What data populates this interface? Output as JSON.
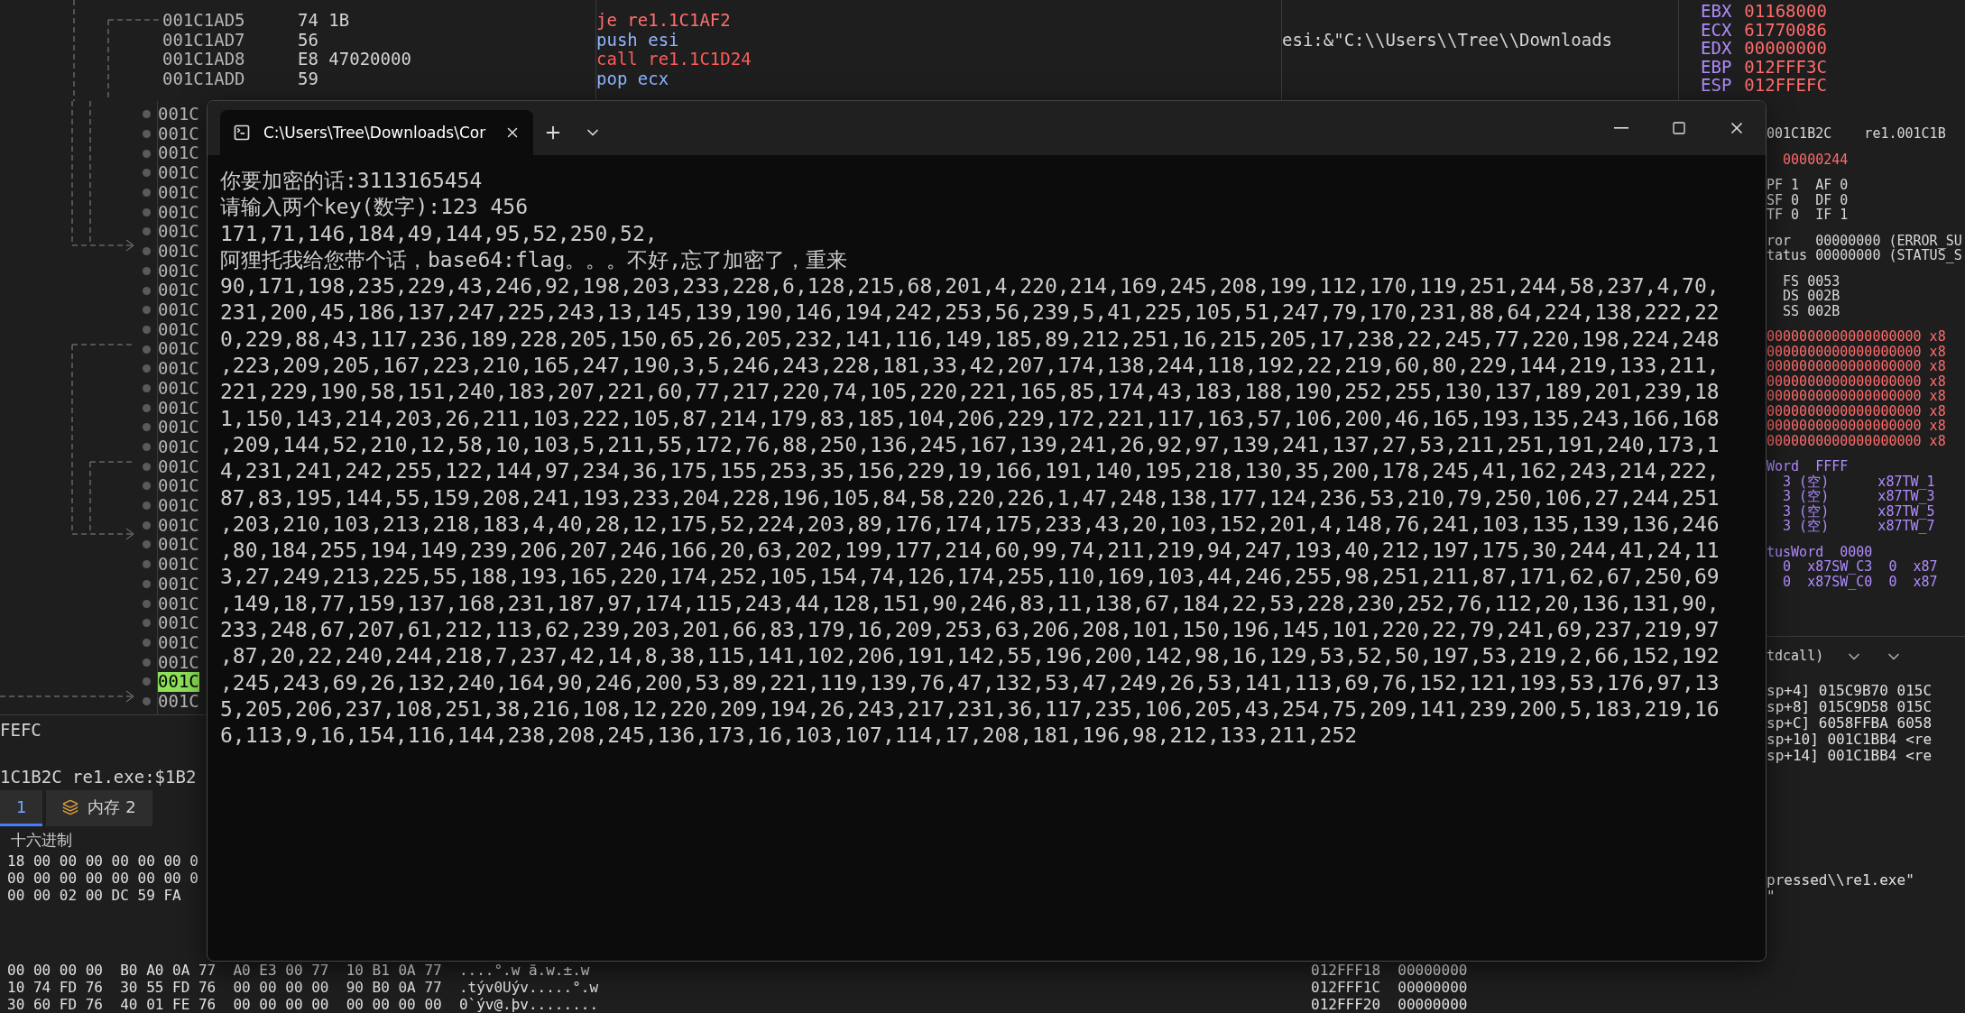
{
  "debugger": {
    "disassembly": [
      {
        "address": "001C1AD5",
        "bytes": "74 1B",
        "op": "je",
        "operand": "re1.1C1AF2",
        "kind": "jump"
      },
      {
        "address": "001C1AD7",
        "bytes": "56",
        "op": "push",
        "operand": "esi",
        "kind": "plain"
      },
      {
        "address": "001C1AD8",
        "bytes": "E8 47020000",
        "op": "call",
        "operand": "re1.1C1D24",
        "kind": "call"
      },
      {
        "address": "001C1ADD",
        "bytes": "59",
        "op": "pop",
        "operand": "ecx",
        "kind": "plain"
      }
    ],
    "comment": "esi:&\"C:\\\\Users\\\\Tree\\\\Downloads",
    "registers": [
      {
        "name": "EBX",
        "value": "01168000"
      },
      {
        "name": "ECX",
        "value": "61770086"
      },
      {
        "name": "EDX",
        "value": "00000000"
      },
      {
        "name": "EBP",
        "value": "012FFF3C"
      },
      {
        "name": "ESP",
        "value": "012FFEFC"
      }
    ],
    "address_column": [
      {
        "text": "001C",
        "selected": false
      },
      {
        "text": "001C",
        "selected": false
      },
      {
        "text": "001C",
        "selected": false
      },
      {
        "text": "001C",
        "selected": false
      },
      {
        "text": "001C",
        "selected": false
      },
      {
        "text": "001C",
        "selected": false
      },
      {
        "text": "001C",
        "selected": false
      },
      {
        "text": "001C",
        "selected": false
      },
      {
        "text": "001C",
        "selected": false
      },
      {
        "text": "001C",
        "selected": false
      },
      {
        "text": "001C",
        "selected": false
      },
      {
        "text": "001C",
        "selected": false
      },
      {
        "text": "001C",
        "selected": false
      },
      {
        "text": "001C",
        "selected": false
      },
      {
        "text": "001C",
        "selected": false
      },
      {
        "text": "001C",
        "selected": false
      },
      {
        "text": "001C",
        "selected": false
      },
      {
        "text": "001C",
        "selected": false
      },
      {
        "text": "001C",
        "selected": false
      },
      {
        "text": "001C",
        "selected": false
      },
      {
        "text": "001C",
        "selected": false
      },
      {
        "text": "001C",
        "selected": false
      },
      {
        "text": "001C",
        "selected": false
      },
      {
        "text": "001C",
        "selected": false
      },
      {
        "text": "001C",
        "selected": false
      },
      {
        "text": "001C",
        "selected": false
      },
      {
        "text": "001C",
        "selected": false
      },
      {
        "text": "001C",
        "selected": false
      },
      {
        "text": "001C",
        "selected": false
      },
      {
        "text": "001C",
        "selected": true
      },
      {
        "text": "001C",
        "selected": false
      }
    ],
    "info_lines": [
      "FEFC",
      "1C1B2C re1.exe:$1B2"
    ],
    "dump_tabs": [
      {
        "label": "1",
        "selected": true
      },
      {
        "label": "内存 2",
        "selected": false
      }
    ],
    "dump_header": "十六进制",
    "dump_rows": [
      "18 00 00 00 00 00 00 0",
      "00 00 00 00 00 00 00 0",
      "00 00 02 00 DC 59 FA"
    ],
    "dump_rows_bottom": [
      "00 00 00 00  B0 A0 0A 77  A0 E3 00 77  10 B1 0A 77  ....°.w ã.w.±.w",
      "10 74 FD 76  30 55 FD 76  00 00 00 00  90 B0 0A 77  .týv0Uýv.....°.w",
      "30 60 FD 76  40 01 FE 76  00 00 00 00  00 00 00 00  0`ýv@.þv........"
    ],
    "stack_bottom": [
      "012FFF18  00000000",
      "012FFF1C  00000000",
      "012FFF20  00000000"
    ],
    "right_sections": [
      {
        "kind": "mixed",
        "lines": [
          "001C1B2C    re1.001C1B"
        ]
      },
      {
        "kind": "changed",
        "lines": [
          "  00000244"
        ]
      },
      {
        "kind": "mixed",
        "lines": [
          "PF 1  AF 0",
          "SF 0  DF 0",
          "TF 0  IF 1"
        ]
      },
      {
        "kind": "mixed",
        "lines": [
          "ror   00000000 (ERROR_SU",
          "tatus 00000000 (STATUS_S"
        ]
      },
      {
        "kind": "mixed",
        "lines": [
          "  FS 0053",
          "  DS 002B",
          "  SS 002B"
        ]
      },
      {
        "kind": "changed",
        "lines": [
          "0000000000000000000 x8",
          "0000000000000000000 x8",
          "0000000000000000000 x8",
          "0000000000000000000 x8",
          "0000000000000000000 x8",
          "0000000000000000000 x8",
          "0000000000000000000 x8",
          "0000000000000000000 x8"
        ]
      },
      {
        "kind": "label",
        "lines": [
          "Word  FFFF",
          "  3 (空)      x87TW_1",
          "  3 (空)      x87TW_3",
          "  3 (空)      x87TW_5",
          "  3 (空)      x87TW_7"
        ]
      },
      {
        "kind": "label",
        "lines": [
          "tusWord  0000",
          "  0  x87SW_C3  0  x87",
          "  0  x87SW_C0  0  x87"
        ]
      }
    ],
    "call_convention": "tdcall)",
    "stack_lines": [
      "sp+4] 015C9B70 015C",
      "sp+8] 015C9D58 015C",
      "sp+C] 6058FFBA 6058",
      "sp+10] 001C1BB4 <re",
      "sp+14] 001C1BB4 <re"
    ],
    "command_lines": [
      "pressed\\\\re1.exe\"",
      "\""
    ]
  },
  "console": {
    "title": "C:\\Users\\Tree\\Downloads\\Cor",
    "lines": [
      "你要加密的话:3113165454",
      "请输入两个key(数字):123 456",
      "171,71,146,184,49,144,95,52,250,52,",
      "阿狸托我给您带个话，base64:flag。。。不好,忘了加密了，重来",
      "90,171,198,235,229,43,246,92,198,203,233,228,6,128,215,68,201,4,220,214,169,245,208,199,112,170,119,251,244,58,237,4,70,",
      "231,200,45,186,137,247,225,243,13,145,139,190,146,194,242,253,56,239,5,41,225,105,51,247,79,170,231,88,64,224,138,222,22",
      "0,229,88,43,117,236,189,228,205,150,65,26,205,232,141,116,149,185,89,212,251,16,215,205,17,238,22,245,77,220,198,224,248",
      ",223,209,205,167,223,210,165,247,190,3,5,246,243,228,181,33,42,207,174,138,244,118,192,22,219,60,80,229,144,219,133,211,",
      "221,229,190,58,151,240,183,207,221,60,77,217,220,74,105,220,221,165,85,174,43,183,188,190,252,255,130,137,189,201,239,18",
      "1,150,143,214,203,26,211,103,222,105,87,214,179,83,185,104,206,229,172,221,117,163,57,106,200,46,165,193,135,243,166,168",
      ",209,144,52,210,12,58,10,103,5,211,55,172,76,88,250,136,245,167,139,241,26,92,97,139,241,137,27,53,211,251,191,240,173,1",
      "4,231,241,242,255,122,144,97,234,36,175,155,253,35,156,229,19,166,191,140,195,218,130,35,200,178,245,41,162,243,214,222,",
      "87,83,195,144,55,159,208,241,193,233,204,228,196,105,84,58,220,226,1,47,248,138,177,124,236,53,210,79,250,106,27,244,251",
      ",203,210,103,213,218,183,4,40,28,12,175,52,224,203,89,176,174,175,233,43,20,103,152,201,4,148,76,241,103,135,139,136,246",
      ",80,184,255,194,149,239,206,207,246,166,20,63,202,199,177,214,60,99,74,211,219,94,247,193,40,212,197,175,30,244,41,24,11",
      "3,27,249,213,225,55,188,193,165,220,174,252,105,154,74,126,174,255,110,169,103,44,246,255,98,251,211,87,171,62,67,250,69",
      ",149,18,77,159,137,168,231,187,97,174,115,243,44,128,151,90,246,83,11,138,67,184,22,53,228,230,252,76,112,20,136,131,90,",
      "233,248,67,207,61,212,113,62,239,203,201,66,83,179,16,209,253,63,206,208,101,150,196,145,101,220,22,79,241,69,237,219,97",
      ",87,20,22,240,244,218,7,237,42,14,8,38,115,141,102,206,191,142,55,196,200,142,98,16,129,53,52,50,197,53,219,2,66,152,192",
      ",245,243,69,26,132,240,164,90,246,200,53,89,221,119,139,76,47,132,53,47,249,26,53,141,113,69,76,152,121,193,53,176,97,13",
      "5,205,206,237,108,251,38,216,108,12,220,209,194,26,243,217,231,36,117,235,106,205,43,254,75,209,141,239,200,5,183,219,16",
      "6,113,9,16,154,116,144,238,208,245,136,173,16,103,107,114,17,208,181,196,98,212,133,211,252"
    ]
  }
}
